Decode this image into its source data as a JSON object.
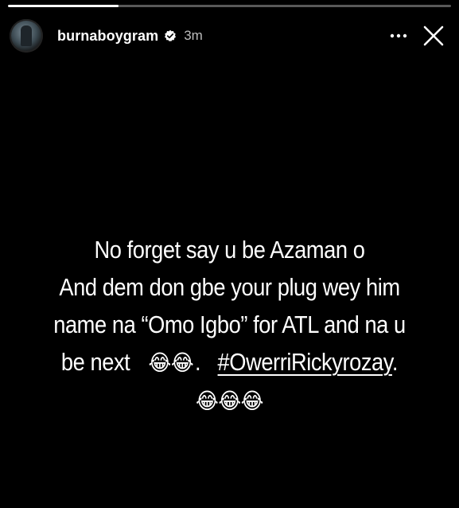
{
  "story": {
    "progress": 0.25
  },
  "header": {
    "username": "burnaboygram",
    "timestamp": "3m",
    "verified": true,
    "avatar_icon": "avatar-icon",
    "more_icon": "more-horizontal-icon",
    "close_icon": "close-icon"
  },
  "caption": {
    "line1": "No forget say u be Azaman o",
    "line2": "And dem don gbe your plug wey him",
    "line3": "name na “Omo Igbo” for ATL and na u",
    "line4_text": "be next",
    "line4_emoji": "😂😂",
    "line4_sep": ".",
    "hashtag": "#OwerriRickyrozay",
    "hashtag_end": ".",
    "line5_emoji": "😂😂😂"
  },
  "colors": {
    "background": "#000000",
    "text": "#ffffff",
    "timestamp": "#bdbdbd",
    "verified_badge": "#ffffff"
  }
}
